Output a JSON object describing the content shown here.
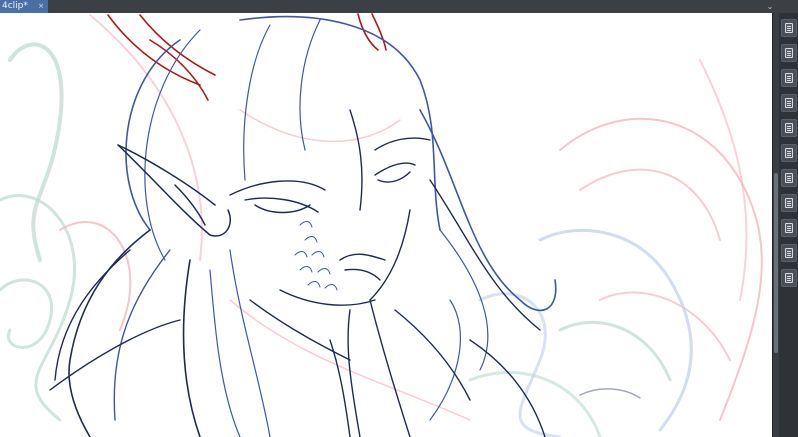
{
  "document_tab": {
    "title": "4clip*",
    "close_glyph": "×"
  },
  "tab_menu_glyph": "⌄",
  "dock": {
    "buttons": [
      {
        "icon": "layer-panel-icon"
      },
      {
        "icon": "property-panel-icon"
      },
      {
        "icon": "navigator-icon"
      },
      {
        "icon": "subtool-panel-icon"
      },
      {
        "icon": "color-panel-icon"
      },
      {
        "icon": "material-panel-icon"
      },
      {
        "icon": "history-panel-icon"
      },
      {
        "icon": "layer-property-icon"
      },
      {
        "icon": "search-layer-icon"
      },
      {
        "icon": "item-bank-icon"
      },
      {
        "icon": "timeline-icon"
      }
    ]
  },
  "colors": {
    "topbar": "#3c3f44",
    "tab_active": "#4a6fa5",
    "dock": "#2f3236",
    "ink_dark": "#1e2a55",
    "ink_blue": "#3b57a8",
    "ink_red": "#b01818",
    "sketch_pink": "#f2b6be",
    "sketch_green": "#b9d8cf",
    "sketch_lightblue": "#c7d3ee"
  }
}
